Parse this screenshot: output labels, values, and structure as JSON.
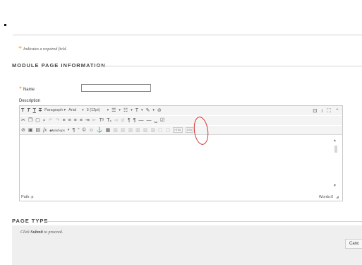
{
  "required_note": {
    "asterisk": "*",
    "text": "Indicates a required field."
  },
  "module_section": {
    "title": "MODULE PAGE INFORMATION"
  },
  "name_field": {
    "asterisk": "*",
    "label": "Name",
    "value": ""
  },
  "description": {
    "label": "Description"
  },
  "toolbar": {
    "row1": {
      "bold": "T",
      "italic": "T",
      "underline": "T",
      "strike": "T",
      "format": "Paragraph",
      "font": "Arial",
      "size": "3 (12pt)",
      "dropdown_glyph": "▾"
    },
    "row1_right": {
      "spell": "⊡",
      "info": "i",
      "fullscreen": "⛶",
      "collapse": "⌃"
    },
    "row3": {
      "mashups": "Mashups",
      "html": "HTML",
      "css": "CSS"
    }
  },
  "statusbar": {
    "path": "Path: p",
    "words": "Words:0"
  },
  "page_type_section": {
    "title": "PAGE TYPE"
  },
  "submit_instructions": {
    "prefix": "Click ",
    "submit": "Submit",
    "suffix": " to proceed."
  },
  "cancel_button": {
    "label": "Canc"
  },
  "colors": {
    "required": "#e8a32a",
    "annotation": "#d53030",
    "box": "#efefef"
  }
}
